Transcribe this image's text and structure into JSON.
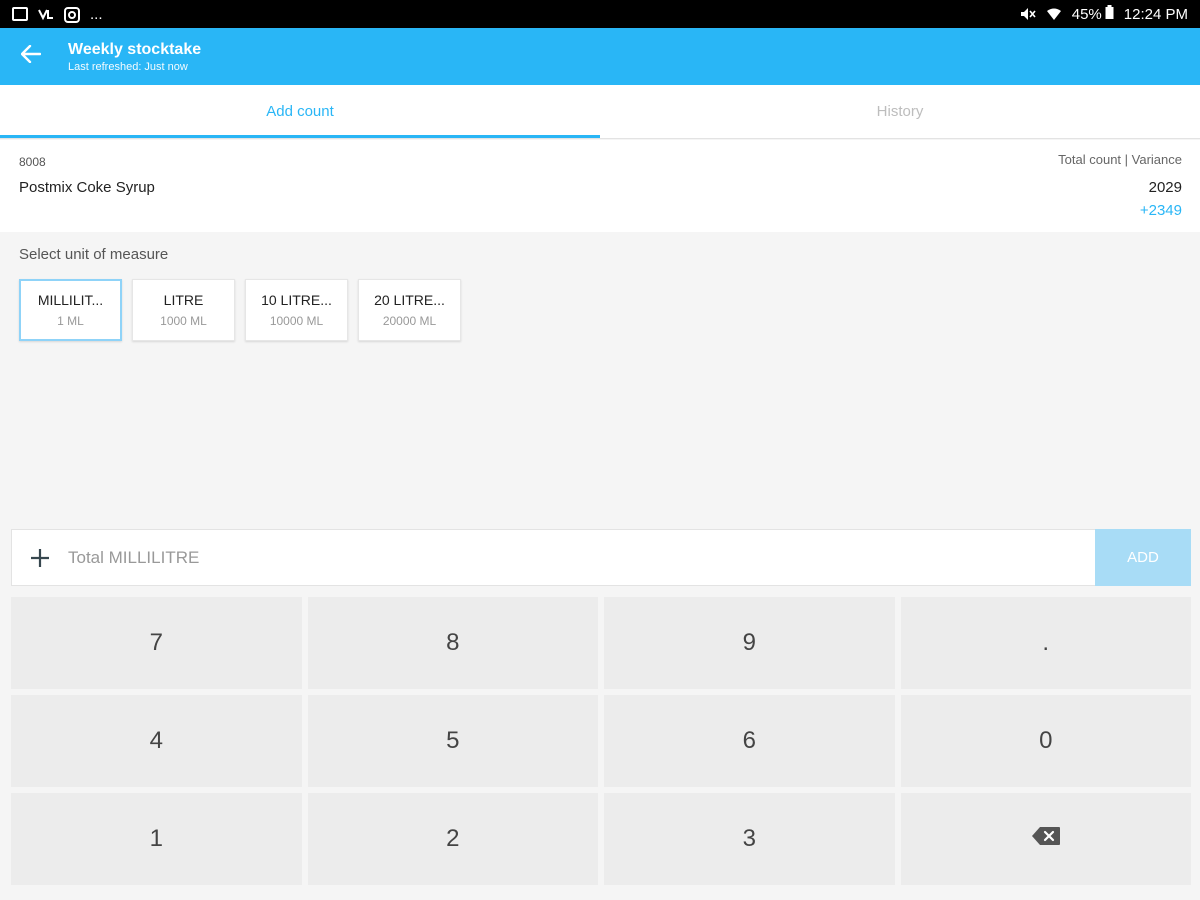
{
  "status_bar": {
    "left_icons": [
      "gallery-icon",
      "vlc-icon",
      "ring-icon"
    ],
    "overflow": "...",
    "right_icons": [
      "mute-icon",
      "wifi-icon",
      "battery-icon"
    ],
    "battery": "45%",
    "time": "12:24 PM"
  },
  "app_bar": {
    "title": "Weekly stocktake",
    "subtitle": "Last refreshed: Just now",
    "back_icon": "arrow-left-icon",
    "color": "#29b6f6"
  },
  "tabs": [
    {
      "label": "Add count",
      "active": true
    },
    {
      "label": "History",
      "active": false
    }
  ],
  "product": {
    "code": "8008",
    "name": "Postmix Coke Syrup",
    "count_label": "Total count | Variance",
    "total_count": "2029",
    "variance": "+2349"
  },
  "unit_of_measure": {
    "label": "Select unit of measure",
    "options": [
      {
        "name": "MILLILIT...",
        "size": "1 ML",
        "selected": true
      },
      {
        "name": "LITRE",
        "size": "1000 ML",
        "selected": false
      },
      {
        "name": "10 LITRE...",
        "size": "10000 ML",
        "selected": false
      },
      {
        "name": "20 LITRE...",
        "size": "20000 ML",
        "selected": false
      }
    ]
  },
  "entry": {
    "icon": "plus-icon",
    "value": "",
    "placeholder": "Total MILLILITRE",
    "add_label": "ADD"
  },
  "keypad": {
    "keys": [
      "7",
      "8",
      "9",
      ".",
      "4",
      "5",
      "6",
      "0",
      "1",
      "2",
      "3",
      "backspace-icon"
    ]
  }
}
